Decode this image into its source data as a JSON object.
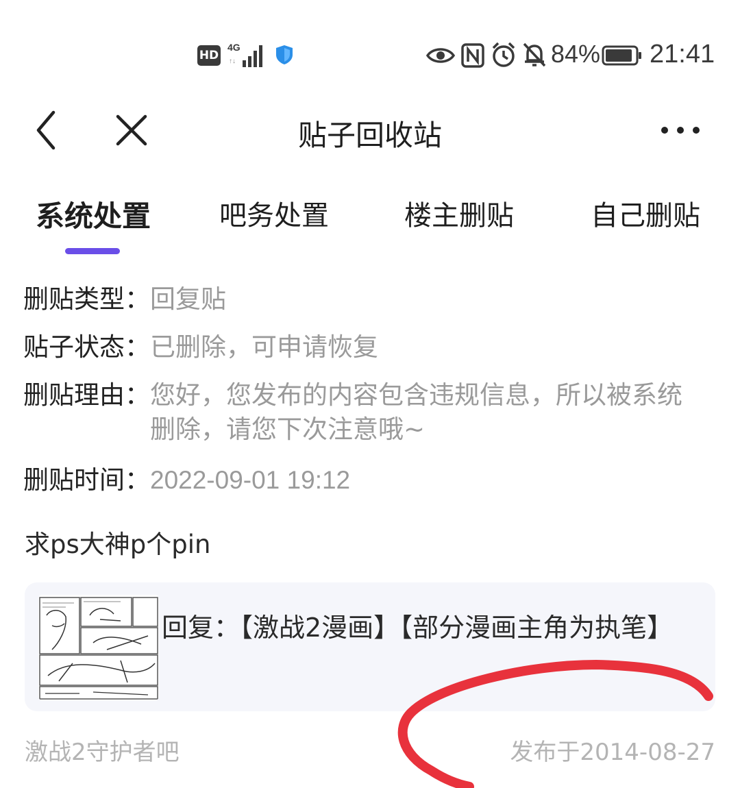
{
  "status_bar": {
    "hd": "HD",
    "network": "4G",
    "battery_percent": "84%",
    "time": "21:41"
  },
  "header": {
    "title": "贴子回收站"
  },
  "tabs": [
    {
      "label": "系统处置",
      "active": true
    },
    {
      "label": "吧务处置",
      "active": false
    },
    {
      "label": "楼主删贴",
      "active": false
    },
    {
      "label": "自己删贴",
      "active": false
    }
  ],
  "details": {
    "type_label": "删贴类型：",
    "type_value": "回复贴",
    "status_label": "贴子状态：",
    "status_value": "已删除，可申请恢复",
    "reason_label": "删贴理由：",
    "reason_value": "您好，您发布的内容包含违规信息，所以被系统删除，请您下次注意哦~",
    "time_label": "删贴时间：",
    "time_value": "2022-09-01 19:12"
  },
  "post": {
    "content": "求ps大神p个pin",
    "quote_text": "回复：【激战2漫画】【部分漫画主角为执笔】",
    "forum": "激战2守护者吧",
    "published": "发布于2014-08-27"
  },
  "colors": {
    "accent": "#6a4ee8",
    "annotation": "#e8323c"
  }
}
